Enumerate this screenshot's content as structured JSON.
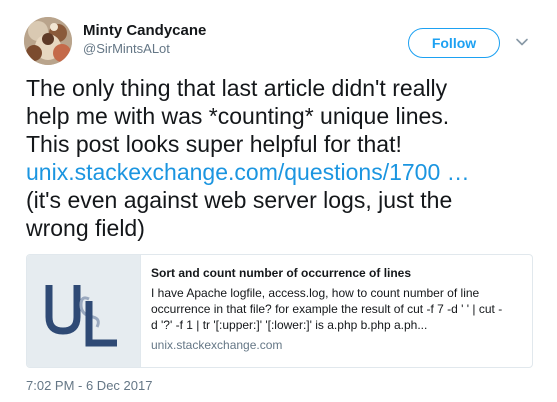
{
  "user": {
    "display_name": "Minty Candycane",
    "handle": "@SirMintsALot",
    "avatar_icon": "avatar-photo"
  },
  "actions": {
    "follow_label": "Follow",
    "more_icon": "chevron-down-icon"
  },
  "tweet": {
    "lines": [
      "The only thing that last article didn't really",
      "help me with was *counting* unique lines.",
      "This post looks super helpful for that!"
    ],
    "link_text": "unix.stackexchange.com/questions/1700  …",
    "after_lines": [
      "(it's even against web server logs, just the",
      "wrong field)"
    ]
  },
  "card": {
    "title": "Sort and count number of occurrence of lines",
    "description_lines": [
      "I have Apache logfile, access.log, how to count number of line",
      "occurrence in that file? for example the result of cut -f 7 -d ' ' | cut -",
      "d '?' -f 1 | tr '[:upper:]' '[:lower:]' is a.php b.php a.ph..."
    ],
    "domain": "unix.stackexchange.com",
    "logo_text": "U&L"
  },
  "timestamp": "7:02 PM - 6 Dec 2017",
  "colors": {
    "link": "#1b95e0",
    "follow": "#1da1f2",
    "muted": "#657786",
    "card_logo": "#2f4a75"
  }
}
